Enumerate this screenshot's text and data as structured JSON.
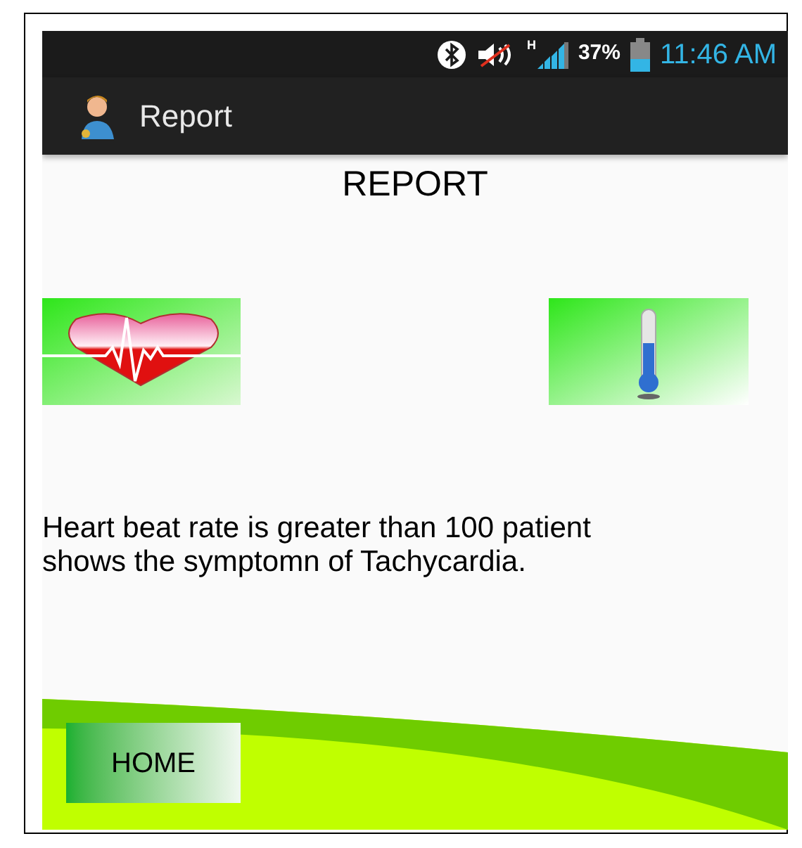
{
  "status_bar": {
    "network_type": "H",
    "battery": "37%",
    "time": "11:46 AM"
  },
  "action_bar": {
    "title": "Report"
  },
  "heading": "REPORT",
  "message": "Heart beat rate is greater than 100 patient shows the symptomn of Tachycardia.",
  "home_button": {
    "label": "HOME"
  }
}
